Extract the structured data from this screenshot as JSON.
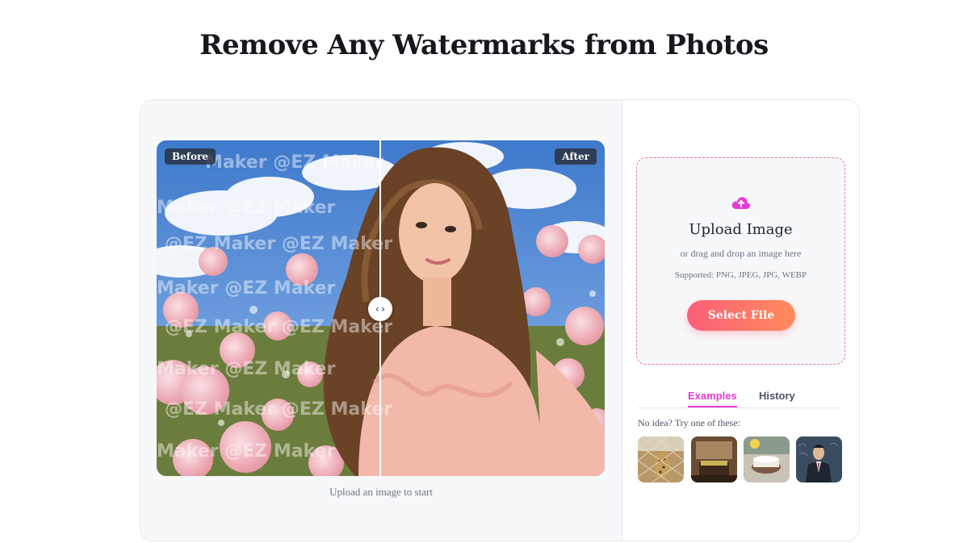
{
  "page": {
    "title": "Remove Any Watermarks from Photos"
  },
  "compare": {
    "before_label": "Before",
    "after_label": "After",
    "watermark_text": "@EZ Maker",
    "handle_icon": "chevron-left-right-icon",
    "hint": "Upload an image to start"
  },
  "upload": {
    "icon": "cloud-upload-icon",
    "title": "Upload Image",
    "subtitle": "or drag and drop an image here",
    "formats": "Supported: PNG, JPEG, JPG, WEBP",
    "button_label": "Select File"
  },
  "tabs": [
    {
      "label": "Examples",
      "active": true
    },
    {
      "label": "History",
      "active": false
    }
  ],
  "examples": {
    "prompt": "No idea? Try one of these:",
    "thumbnails": [
      {
        "name": "example-cheetah-fence"
      },
      {
        "name": "example-vintage-interior"
      },
      {
        "name": "example-cake-table"
      },
      {
        "name": "example-man-in-suit"
      }
    ]
  },
  "colors": {
    "accent": "#e63bd6",
    "button_start": "#fb5f78",
    "button_end": "#ff8c5a"
  }
}
